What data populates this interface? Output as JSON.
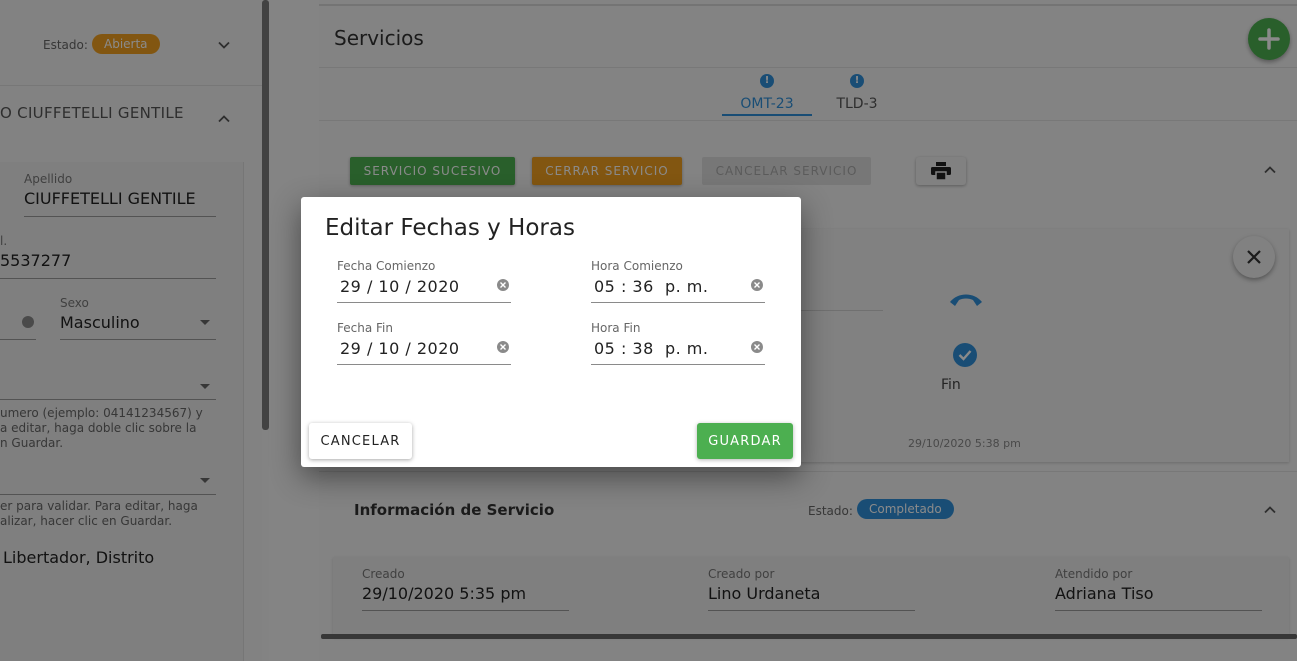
{
  "left_panel": {
    "estado_label": "Estado:",
    "estado_badge": "Abierta",
    "client_name": "O CIUFFETELLI GENTILE",
    "apellido_label": "Apellido",
    "apellido_value": "CIUFFETELLI GENTILE",
    "phone_label": "l.",
    "phone_value": "5537277",
    "sexo_label": "Sexo",
    "sexo_value": "Masculino",
    "helper_phone": [
      "umero (ejemplo: 04141234567) y",
      "a editar, haga doble clic sobre la",
      "n Guardar."
    ],
    "helper_address": [
      "er para validar. Para editar, haga",
      "alizar, hacer clic en Guardar."
    ],
    "address_value": "Libertador, Distrito"
  },
  "main": {
    "title": "Servicios",
    "tabs": [
      {
        "label": "OMT-23",
        "alert": "!"
      },
      {
        "label": "TLD-3",
        "alert": "!"
      }
    ],
    "buttons": {
      "sucesivo": "SERVICIO SUCESIVO",
      "cerrar": "CERRAR SERVICIO",
      "cancelar": "CANCELAR SERVICIO"
    },
    "timeline": {
      "fin_label": "Fin",
      "fin_date": "29/10/2020 5:38 pm"
    },
    "info": {
      "header": "Información de Servicio",
      "estado_label": "Estado:",
      "estado_badge": "Completado",
      "creado_label": "Creado",
      "creado_value": "29/10/2020 5:35 pm",
      "creado_por_label": "Creado por",
      "creado_por_value": "Lino Urdaneta",
      "atendido_label": "Atendido por",
      "atendido_value": "Adriana Tiso"
    }
  },
  "dialog": {
    "title": "Editar Fechas y Horas",
    "fecha_comienzo_label": "Fecha Comienzo",
    "fecha_comienzo_value": "29 / 10 / 2020",
    "hora_comienzo_label": "Hora Comienzo",
    "hora_comienzo_value": "05 : 36  p. m.",
    "fecha_fin_label": "Fecha Fin",
    "fecha_fin_value": "29 / 10 / 2020",
    "hora_fin_label": "Hora Fin",
    "hora_fin_value": "05 : 38  p. m.",
    "cancel_label": "CANCELAR",
    "save_label": "GUARDAR"
  },
  "colors": {
    "primary_blue": "#2f8fd8",
    "success_green": "#4caf50",
    "warning_orange": "#f0a020"
  }
}
